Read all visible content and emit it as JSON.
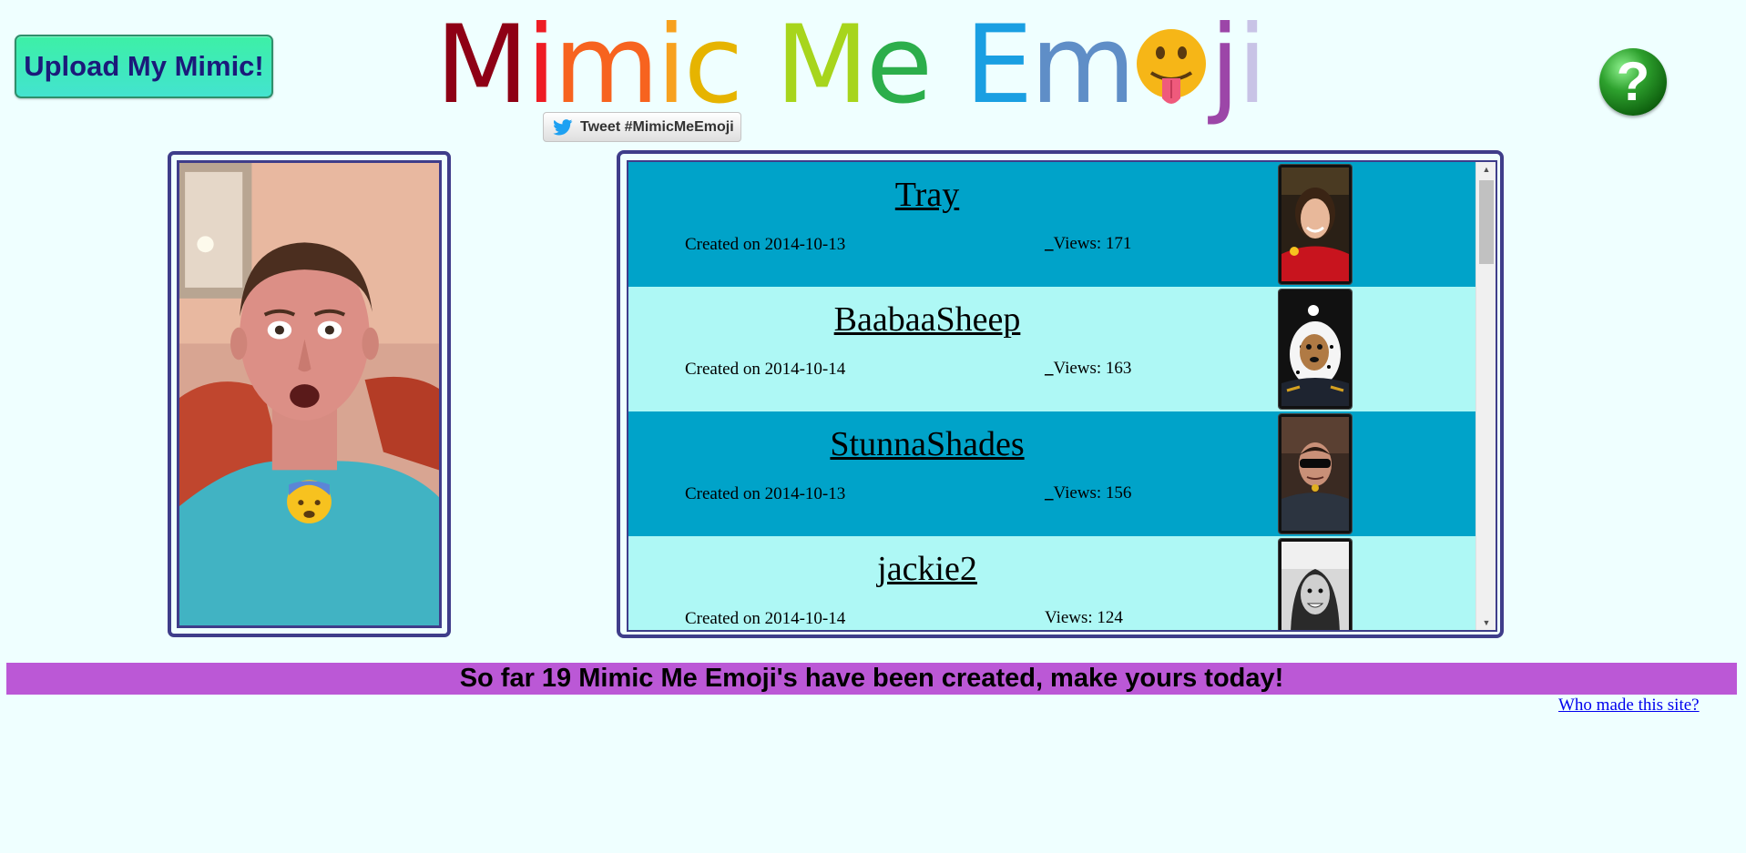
{
  "header": {
    "upload_label": "Upload My Mimic!",
    "title_letters": [
      {
        "ch": "M",
        "color": "#8e0015"
      },
      {
        "ch": "i",
        "color": "#ee1c24"
      },
      {
        "ch": "m",
        "color": "#f7631f"
      },
      {
        "ch": "i",
        "color": "#f7a11f"
      },
      {
        "ch": "c",
        "color": "#e6b400"
      },
      {
        "ch": " ",
        "color": "#000000"
      },
      {
        "ch": "M",
        "color": "#a7d51c"
      },
      {
        "ch": "e",
        "color": "#2cae4b"
      },
      {
        "ch": " ",
        "color": "#000000"
      },
      {
        "ch": "E",
        "color": "#1a9fe2"
      },
      {
        "ch": "m",
        "color": "#5f8ec7"
      },
      {
        "ch": "o",
        "color": "#f6b617",
        "emoji": true
      },
      {
        "ch": "j",
        "color": "#9c46a8"
      },
      {
        "ch": "i",
        "color": "#c8c3e6"
      }
    ],
    "tweet_label": "Tweet #MimicMeEmoji",
    "help_symbol": "?"
  },
  "icons": {
    "help": "question-mark-icon",
    "twitter": "twitter-bird-icon",
    "emoji": "tongue-out-emoji-icon"
  },
  "feed": {
    "items": [
      {
        "name": "Tray",
        "created": "Created on 2014-10-13",
        "views_prefix": "_",
        "views": "Views: 171",
        "bg": "#00a3c9"
      },
      {
        "name": "BaabaaSheep",
        "created": "Created on 2014-10-14",
        "views_prefix": "_",
        "views": "Views: 163",
        "bg": "#aef8f5"
      },
      {
        "name": "StunnaShades",
        "created": "Created on 2014-10-13",
        "views_prefix": "_",
        "views": "Views: 156",
        "bg": "#00a3c9"
      },
      {
        "name": "jackie2",
        "created": "Created on 2014-10-14",
        "views_prefix": "",
        "views": "Views: 124",
        "bg": "#aef8f5"
      }
    ]
  },
  "footer": {
    "banner": "So far 19 Mimic Me Emoji's have been created, make yours today!",
    "who_link": "Who made this site?"
  }
}
